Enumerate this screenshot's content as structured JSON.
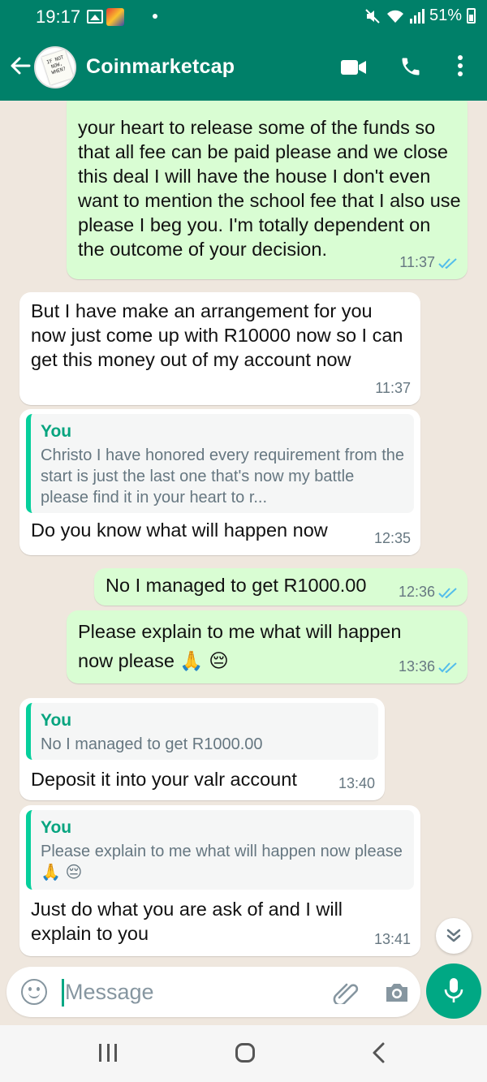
{
  "status_bar": {
    "time": "19:17",
    "battery": "51%"
  },
  "header": {
    "contact_name": "Coinmarketcap",
    "avatar_text": "IF NOT NOW, WHEN?"
  },
  "messages": [
    {
      "direction": "outgoing",
      "text": "your heart to release some of the funds so that all fee can be paid please and we close this deal I will have the house I don't even want to mention the school fee that I also use please I beg you. I'm totally dependent on the outcome of your decision.",
      "time": "11:37",
      "read": true
    },
    {
      "direction": "incoming",
      "text": "But I have make an arrangement for you now just come up with R10000 now so I can get this money out of my account now",
      "time": "11:37"
    },
    {
      "direction": "incoming",
      "quote_author": "You",
      "quote_text": "Christo I  have honored every requirement from the start is just the last one that's now my battle please find it in your heart to r...",
      "text": "Do you know what will happen now",
      "time": "12:35"
    },
    {
      "direction": "outgoing",
      "text": "No I managed to get R1000.00",
      "time": "12:36",
      "read": true
    },
    {
      "direction": "outgoing",
      "text": "Please explain to me what will happen now please 🙏 😔",
      "time": "13:36",
      "read": true
    },
    {
      "direction": "incoming",
      "quote_author": "You",
      "quote_text": "No I managed to get R1000.00",
      "text": "Deposit it into your valr account",
      "time": "13:40"
    },
    {
      "direction": "incoming",
      "quote_author": "You",
      "quote_text": "Please explain to me what will happen now please 🙏 😔",
      "text": "Just do what you are ask of and I will explain to you",
      "time": "13:41"
    }
  ],
  "input": {
    "placeholder": "Message"
  },
  "colors": {
    "header": "#008069",
    "outgoing_bubble": "#d9fdd3",
    "incoming_bubble": "#ffffff",
    "accent": "#00a884",
    "read_ticks": "#53bdeb"
  },
  "icons": [
    "back-arrow-icon",
    "video-call-icon",
    "phone-icon",
    "more-options-icon",
    "emoji-icon",
    "attach-icon",
    "camera-icon",
    "mic-icon",
    "scroll-down-icon"
  ]
}
